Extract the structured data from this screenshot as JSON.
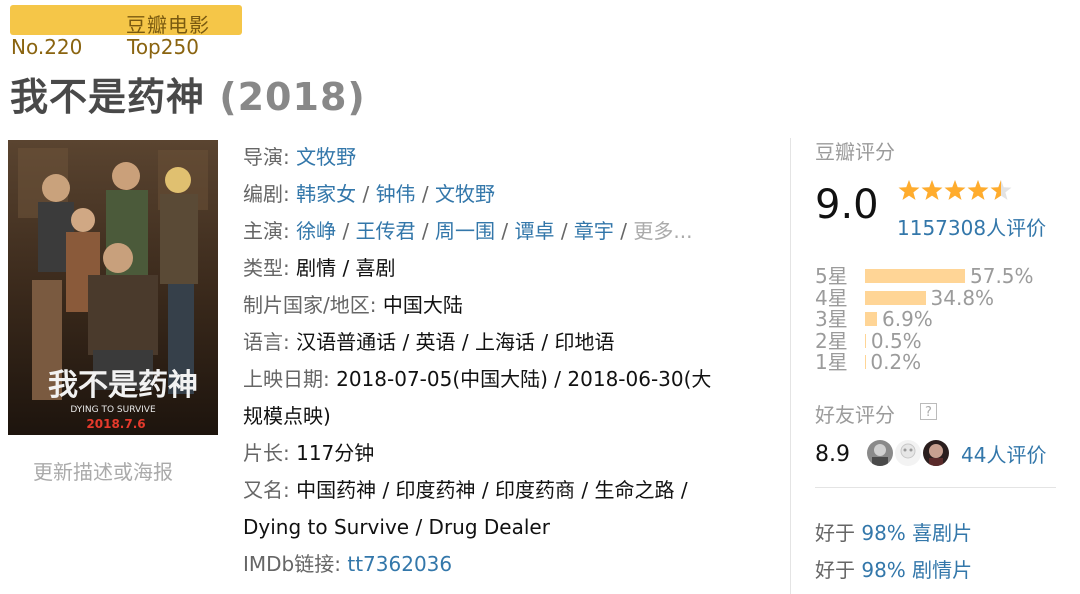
{
  "badge": {
    "label": "豆瓣电影"
  },
  "rank": {
    "no": "No.220",
    "top": "Top250"
  },
  "movie": {
    "title": "我不是药神",
    "year": "(2018)"
  },
  "poster": {
    "alt": "我不是药神 海报",
    "title_cn": "我不是药神",
    "title_en": "DYING TO SURVIVE",
    "date": "2018.7.6"
  },
  "update_link": "更新描述或海报",
  "info": {
    "sep": " / ",
    "director_label": "导演",
    "directors": [
      "文牧野"
    ],
    "writer_label": "编剧",
    "writers": [
      "韩家女",
      "钟伟",
      "文牧野"
    ],
    "cast_label": "主演",
    "cast": [
      "徐峥",
      "王传君",
      "周一围",
      "谭卓",
      "章宇"
    ],
    "cast_more": "更多...",
    "genre_label": "类型:",
    "genres": "剧情 / 喜剧",
    "country_label": "制片国家/地区:",
    "country": "中国大陆",
    "language_label": "语言:",
    "languages": "汉语普通话 / 英语 / 上海话 / 印地语",
    "release_label": "上映日期:",
    "release_line1": "2018-07-05(中国大陆) / 2018-06-30(大",
    "release_line2": "规模点映)",
    "runtime_label": "片长:",
    "runtime": "117分钟",
    "aka_label": "又名:",
    "aka_line1": "中国药神 / 印度药神 / 印度药商 / 生命之路 /",
    "aka_line2": "Dying to Survive / Drug Dealer",
    "imdb_label": "IMDb链接:",
    "imdb_id": "tt7362036"
  },
  "rating": {
    "title": "豆瓣评分",
    "score": "9.0",
    "stars_value": 4.5,
    "votes": "1157308人评价",
    "distribution": [
      {
        "label": "5星",
        "percent": "57.5%",
        "value": 57.5
      },
      {
        "label": "4星",
        "percent": "34.8%",
        "value": 34.8
      },
      {
        "label": "3星",
        "percent": "6.9%",
        "value": 6.9
      },
      {
        "label": "2星",
        "percent": "0.5%",
        "value": 0.5
      },
      {
        "label": "1星",
        "percent": "0.2%",
        "value": 0.2
      }
    ],
    "friends_title": "好友评分",
    "friends_help_icon": "question-icon",
    "friends_score": "8.9",
    "friends_votes": "44人评价",
    "better_than": [
      {
        "prefix": "好于 ",
        "percent": "98%",
        "genre": "喜剧片"
      },
      {
        "prefix": "好于 ",
        "percent": "98%",
        "genre": "剧情片"
      }
    ]
  },
  "colors": {
    "badge": "#f5c648",
    "link": "#3377aa",
    "star": "#ffac2d",
    "bar": "#ffd596"
  }
}
